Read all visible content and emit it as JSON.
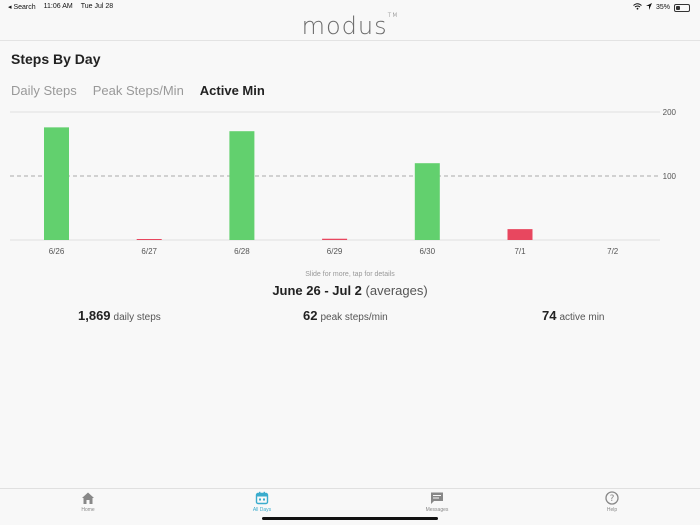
{
  "status": {
    "back": "◂ Search",
    "time": "11:06 AM",
    "date": "Tue Jul 28",
    "battery": "35%"
  },
  "app": {
    "logo": "modus",
    "trademark": "TM"
  },
  "page": {
    "title": "Steps By Day"
  },
  "tabs": [
    {
      "label": "Daily Steps",
      "active": false
    },
    {
      "label": "Peak Steps/Min",
      "active": false
    },
    {
      "label": "Active Min",
      "active": true
    }
  ],
  "chart_data": {
    "type": "bar",
    "categories": [
      "6/26",
      "6/27",
      "6/28",
      "6/29",
      "6/30",
      "7/1",
      "7/2"
    ],
    "values": [
      176,
      1,
      170,
      2,
      120,
      17,
      0
    ],
    "bar_colors": [
      "#62d06e",
      "#e8475f",
      "#62d06e",
      "#e8475f",
      "#62d06e",
      "#e8475f",
      "#62d06e"
    ],
    "yticks": [
      100,
      200
    ],
    "ylim": [
      0,
      200
    ],
    "reference_line": 100
  },
  "summary": {
    "hint": "Slide for more, tap for details",
    "range": "June 26 - Jul 2",
    "range_suffix": "(averages)"
  },
  "stats": [
    {
      "value": "1,869",
      "label": "daily steps"
    },
    {
      "value": "62",
      "label": "peak steps/min"
    },
    {
      "value": "74",
      "label": "active min"
    }
  ],
  "nav": [
    {
      "label": "Home",
      "icon": "home-icon",
      "active": false
    },
    {
      "label": "All Days",
      "icon": "calendar-icon",
      "active": true
    },
    {
      "label": "Messages",
      "icon": "message-icon",
      "active": false
    },
    {
      "label": "Help",
      "icon": "help-icon",
      "active": false
    }
  ],
  "colors": {
    "positive": "#62d06e",
    "negative": "#e8475f",
    "accent": "#3aaccd"
  }
}
